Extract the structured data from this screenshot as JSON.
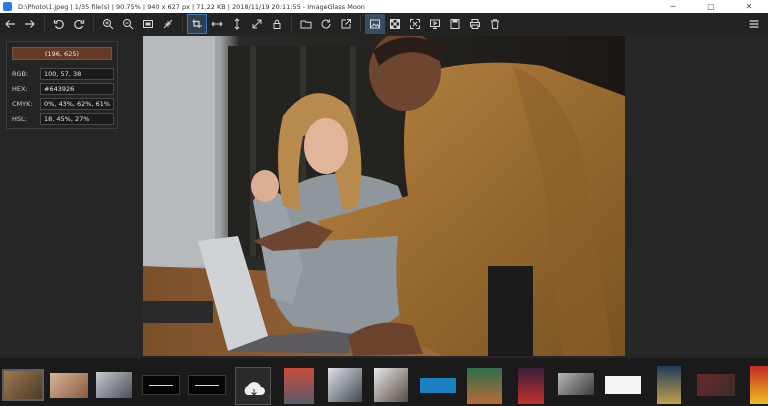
{
  "window": {
    "title": "D:\\Photo\\1.jpeg  |  1/35 file(s)  |  90.75%  |  940 x 627 px  |  71.22 KB  |  2018/11/19 20:11:55  -  ImageGlass Moon",
    "controls": [
      "─",
      "▢",
      "✕"
    ]
  },
  "toolbar": {
    "icons": [
      "arrow-left-icon",
      "arrow-right-icon",
      "rotate-left-icon",
      "rotate-right-icon",
      "zoom-in-icon",
      "zoom-out-icon",
      "actual-size-icon",
      "scale-to-fit-icon",
      "lock-zoom-icon",
      "fit-width-icon",
      "fit-height-icon",
      "scale-to-fill-icon",
      "lock-icon",
      "open-folder-icon",
      "refresh-icon",
      "edit-icon",
      "thumbnail-icon",
      "checkerboard-icon",
      "fullscreen-icon",
      "slideshow-icon",
      "convert-icon",
      "print-icon",
      "delete-icon",
      "menu-icon"
    ]
  },
  "color_picker": {
    "coords": "(196, 625)",
    "swatch_color": "#643926",
    "rows": [
      {
        "label": "RGB:",
        "value": "100, 57, 38"
      },
      {
        "label": "HEX:",
        "value": "#643926"
      },
      {
        "label": "CMYK:",
        "value": "0%, 43%, 62%, 61%"
      },
      {
        "label": "HSL:",
        "value": "18, 45%, 27%"
      }
    ]
  },
  "thumbnails": {
    "count": 18,
    "selected_index": 0
  }
}
